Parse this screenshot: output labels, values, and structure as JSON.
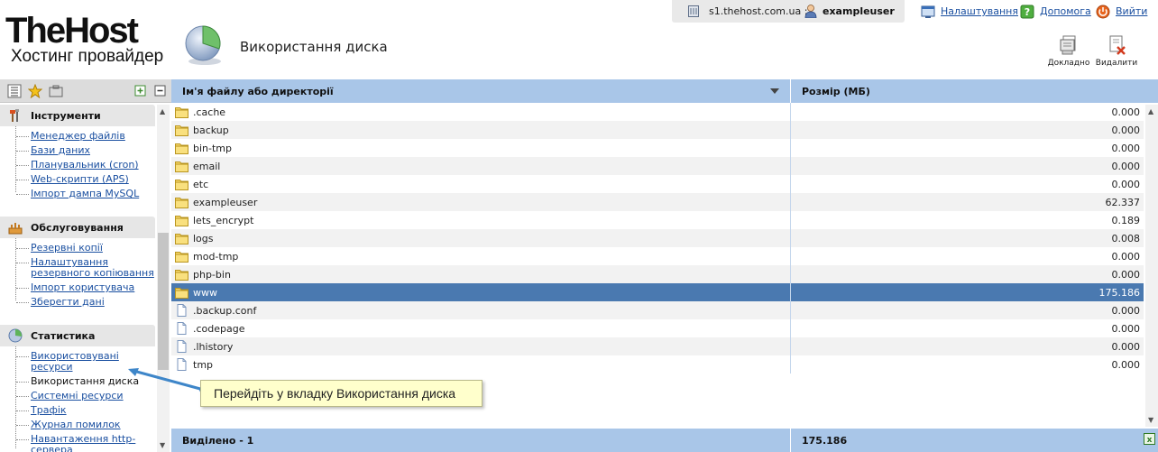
{
  "brand": {
    "name": "TheHost",
    "tagline": "Хостинг провайдер"
  },
  "page": {
    "title": "Використання диска"
  },
  "topbar": {
    "server": "s1.thehost.com.ua ::",
    "user": "exampleuser"
  },
  "toplinks": {
    "settings": "Налаштування",
    "help": "Допомога",
    "logout": "Вийти"
  },
  "actions": {
    "details": "Докладно",
    "delete": "Видалити"
  },
  "sidebar": {
    "sections": [
      {
        "title": "Інструменти",
        "icon": "tools-icon",
        "items": [
          "Менеджер файлів",
          "Бази даних",
          "Планувальник (cron)",
          "Web-скрипти (APS)",
          "Імпорт дампа MySQL"
        ]
      },
      {
        "title": "Обслуговування",
        "icon": "maintenance-icon",
        "items": [
          "Резервні копії",
          "Налаштування резервного копіювання",
          "Імпорт користувача",
          "Зберегти дані"
        ]
      },
      {
        "title": "Статистика",
        "icon": "statistics-icon",
        "items": [
          "Використовувані ресурси",
          "Використання диска",
          "Системні ресурси",
          "Трафік",
          "Журнал помилок",
          "Навантаження http-сервера"
        ]
      }
    ]
  },
  "table": {
    "columns": {
      "name": "Ім'я файлу або директорії",
      "size": "Розмір (МБ)"
    },
    "rows": [
      {
        "name": ".cache",
        "size": "0.000",
        "type": "folder"
      },
      {
        "name": "backup",
        "size": "0.000",
        "type": "folder"
      },
      {
        "name": "bin-tmp",
        "size": "0.000",
        "type": "folder"
      },
      {
        "name": "email",
        "size": "0.000",
        "type": "folder"
      },
      {
        "name": "etc",
        "size": "0.000",
        "type": "folder"
      },
      {
        "name": "exampleuser",
        "size": "62.337",
        "type": "folder"
      },
      {
        "name": "lets_encrypt",
        "size": "0.189",
        "type": "folder"
      },
      {
        "name": "logs",
        "size": "0.008",
        "type": "folder"
      },
      {
        "name": "mod-tmp",
        "size": "0.000",
        "type": "folder"
      },
      {
        "name": "php-bin",
        "size": "0.000",
        "type": "folder"
      },
      {
        "name": "www",
        "size": "175.186",
        "type": "folder",
        "selected": true
      },
      {
        "name": ".backup.conf",
        "size": "0.000",
        "type": "file"
      },
      {
        "name": ".codepage",
        "size": "0.000",
        "type": "file"
      },
      {
        "name": ".lhistory",
        "size": "0.000",
        "type": "file"
      },
      {
        "name": "tmp",
        "size": "0.000",
        "type": "file"
      }
    ],
    "footer": {
      "selected_label": "Виділено - 1",
      "total": "175.186"
    }
  },
  "tooltip": {
    "text": "Перейдіть у вкладку Використання диска"
  },
  "colors": {
    "header_blue": "#a9c6e8",
    "selected_row": "#4a79b0",
    "link": "#1a4fa0",
    "tooltip_bg": "#ffffcc"
  }
}
